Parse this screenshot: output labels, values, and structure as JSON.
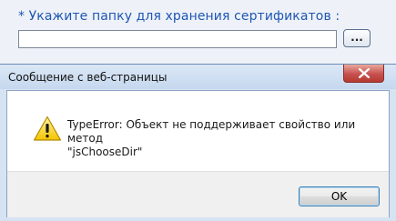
{
  "page": {
    "folder_label": "* Укажите папку для хранения сертификатов :",
    "folder_input_value": "",
    "browse_label": "..."
  },
  "dialog": {
    "title": "Сообщение с веб-страницы",
    "message_line1": "TypeError: Объект не поддерживает свойство или метод",
    "message_line2": "\"jsChooseDir\"",
    "ok_label": "OK",
    "icon": "warning-icon",
    "close_icon": "close-icon"
  },
  "colors": {
    "label_blue": "#1f56b3",
    "close_red": "#c75050",
    "warning_yellow": "#f5c400"
  }
}
